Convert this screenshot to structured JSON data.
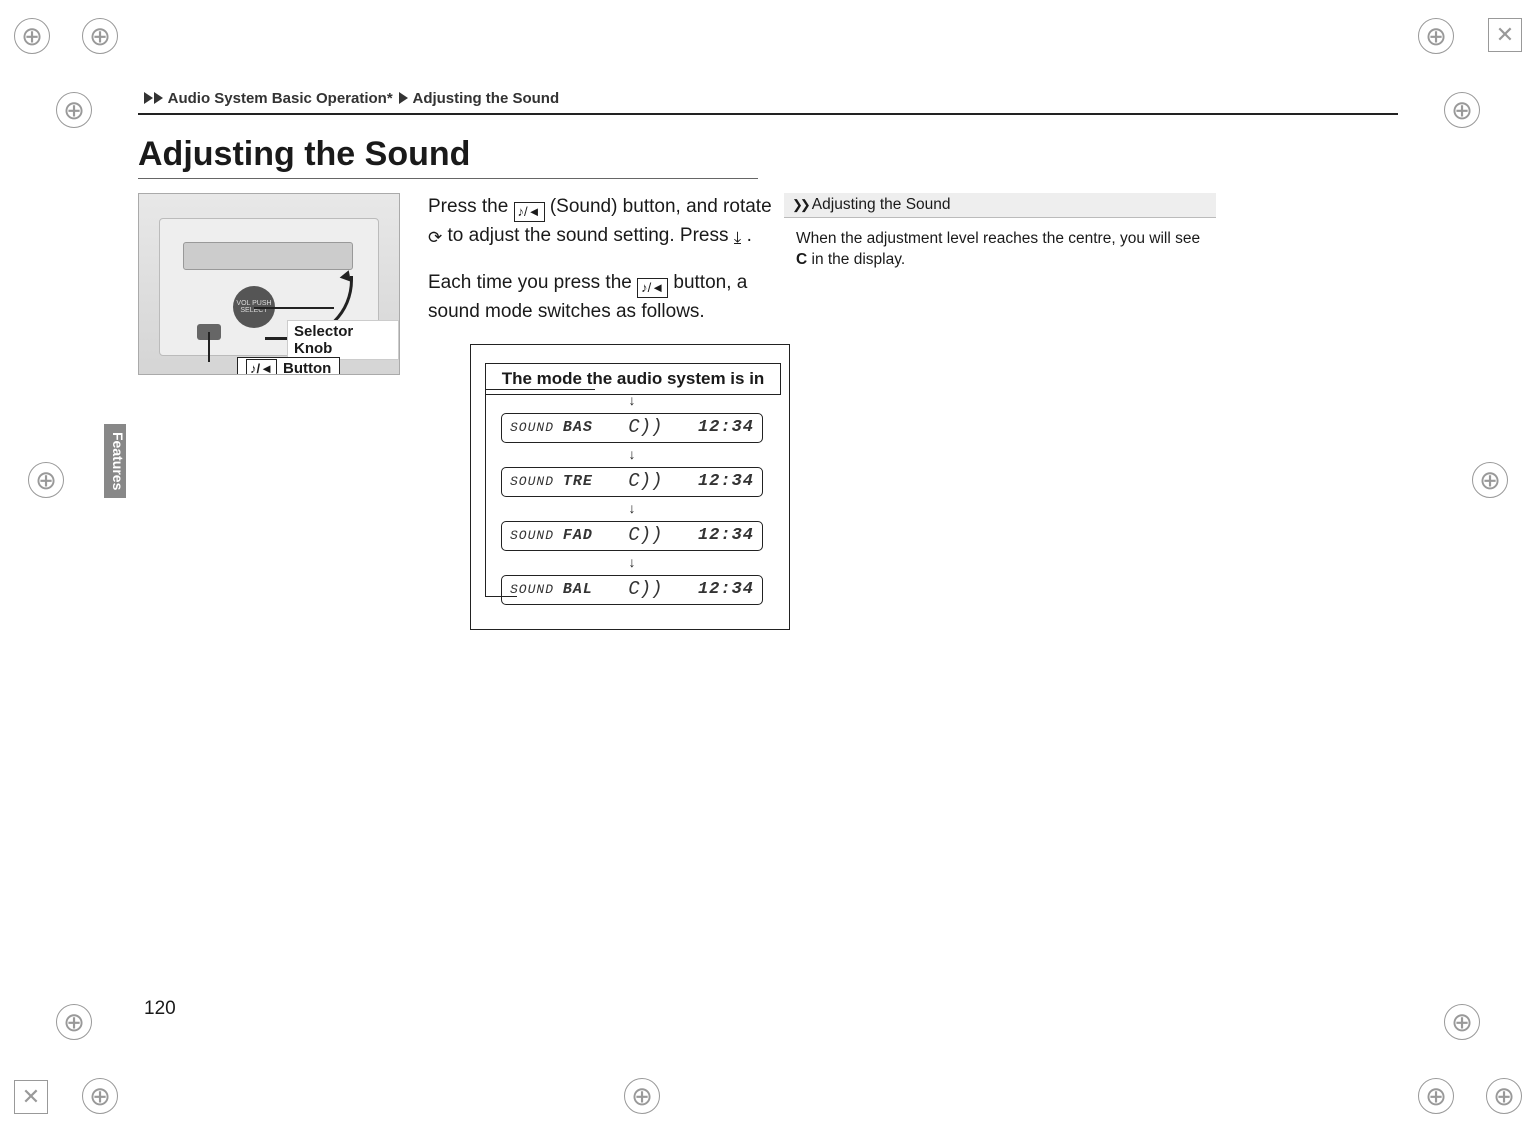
{
  "breadcrumb": {
    "part1": "Audio System Basic Operation*",
    "part2": "Adjusting the Sound"
  },
  "title": "Adjusting the Sound",
  "side_tab": "Features",
  "photo": {
    "knob_text": "VOL\nPUSH\nSELECT",
    "callout_knob": "Selector Knob",
    "callout_button": "Button"
  },
  "body": {
    "p1a": "Press the ",
    "p1b": " (Sound) button, and rotate ",
    "p1c": " to adjust the sound setting. Press ",
    "p1d": ".",
    "p2a": "Each time you press the ",
    "p2b": " button, a sound mode switches as follows."
  },
  "flow": {
    "top": "The mode the audio system is in",
    "labelLeft": "SOUND",
    "modes": [
      "BAS",
      "TRE",
      "FAD",
      "BAL"
    ],
    "center_glyph": "C))",
    "time": "12:34"
  },
  "icons": {
    "sound_btn": "♪/◄",
    "rotate": "⟳",
    "push": "⤓"
  },
  "sidebox": {
    "title": "Adjusting the Sound",
    "body_a": "When the adjustment level reaches the centre, you will see ",
    "body_c": "C",
    "body_b": " in the display."
  },
  "page_number": "120"
}
